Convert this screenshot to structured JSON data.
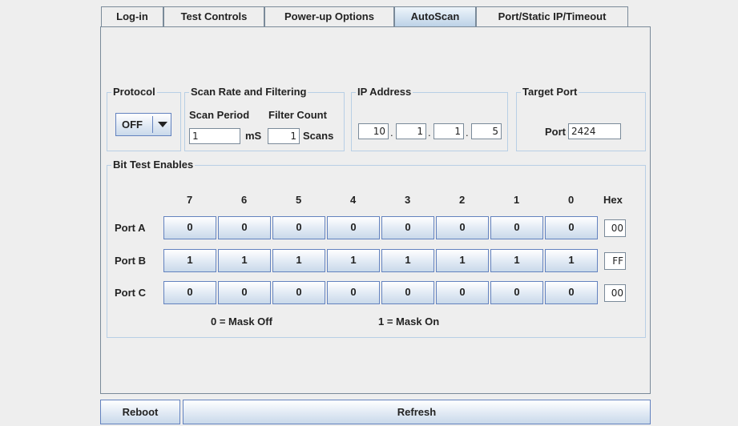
{
  "tabs": [
    "Log-in",
    "Test Controls",
    "Power-up Options",
    "AutoScan",
    "Port/Static IP/Timeout"
  ],
  "active_tab": "AutoScan",
  "protocol": {
    "label": "Protocol",
    "value": "OFF"
  },
  "scan_rate": {
    "label": "Scan Rate and Filtering",
    "scan_period_label": "Scan Period",
    "filter_count_label": "Filter Count",
    "scan_period_value": "1",
    "scan_period_unit": "mS",
    "filter_count_value": "1",
    "filter_count_unit": "Scans"
  },
  "ip_address": {
    "label": "IP Address",
    "octets": [
      "10",
      "1",
      "1",
      "5"
    ],
    "separator": "."
  },
  "target_port": {
    "label": "Target Port",
    "port_label": "Port",
    "port_value": "2424"
  },
  "bit_test": {
    "label": "Bit Test Enables",
    "bit_headers": [
      "7",
      "6",
      "5",
      "4",
      "3",
      "2",
      "1",
      "0"
    ],
    "hex_header": "Hex",
    "ports": [
      {
        "name": "Port A",
        "bits": [
          "0",
          "0",
          "0",
          "0",
          "0",
          "0",
          "0",
          "0"
        ],
        "hex": "00"
      },
      {
        "name": "Port B",
        "bits": [
          "1",
          "1",
          "1",
          "1",
          "1",
          "1",
          "1",
          "1"
        ],
        "hex": "FF"
      },
      {
        "name": "Port C",
        "bits": [
          "0",
          "0",
          "0",
          "0",
          "0",
          "0",
          "0",
          "0"
        ],
        "hex": "00"
      }
    ],
    "legend_off": "0 = Mask Off",
    "legend_on": "1 = Mask On"
  },
  "footer": {
    "reboot": "Reboot",
    "refresh": "Refresh"
  }
}
